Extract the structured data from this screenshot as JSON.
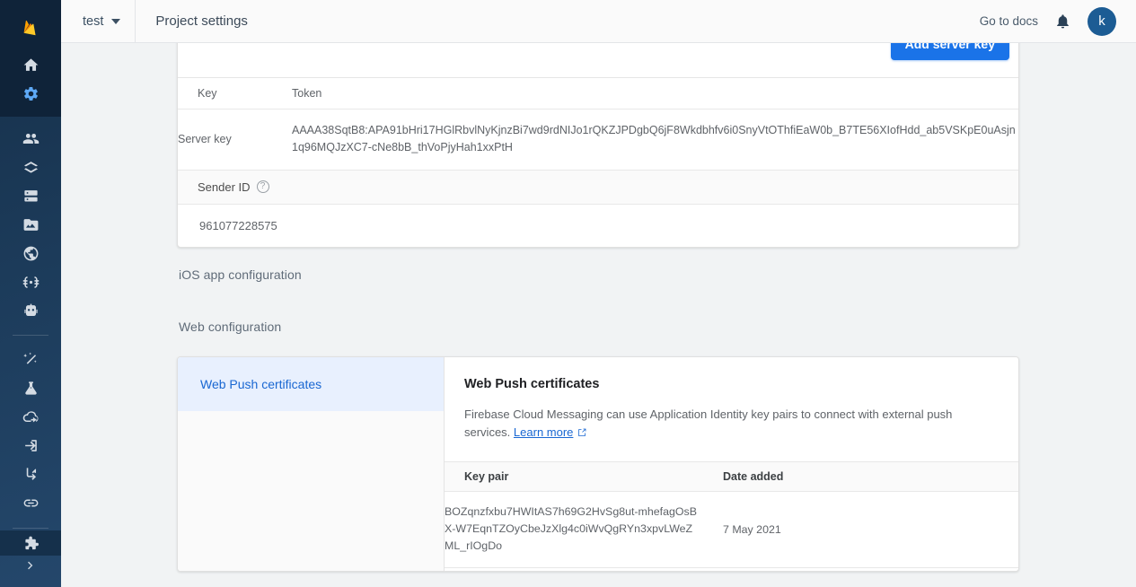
{
  "header": {
    "project_name": "test",
    "page_title": "Project settings",
    "go_to_docs": "Go to docs",
    "avatar_initial": "k",
    "accent_blue": "#1a73e8",
    "logo": "firebase-flame-logo"
  },
  "sidebar": {
    "items": [
      {
        "name": "home",
        "icon": "home-icon",
        "active": false
      },
      {
        "name": "project-settings",
        "icon": "gear-icon",
        "active": true
      },
      {
        "name": "authentication",
        "icon": "people-icon",
        "active": false
      },
      {
        "name": "firestore-database",
        "icon": "firestore-icon",
        "active": false
      },
      {
        "name": "realtime-database",
        "icon": "database-icon",
        "active": false
      },
      {
        "name": "storage",
        "icon": "folder-image-icon",
        "active": false
      },
      {
        "name": "hosting",
        "icon": "globe-icon",
        "active": false
      },
      {
        "name": "functions",
        "icon": "braces-icon",
        "active": false
      },
      {
        "name": "machine-learning",
        "icon": "robot-icon",
        "active": false
      },
      {
        "name": "crashlytics",
        "icon": "magic-wand-icon",
        "active": false
      },
      {
        "name": "ab-testing",
        "icon": "flask-icon",
        "active": false
      },
      {
        "name": "cloud-messaging",
        "icon": "cloud-arrow-icon",
        "active": false
      },
      {
        "name": "app-distribution",
        "icon": "login-arrow-icon",
        "active": false
      },
      {
        "name": "remote-config",
        "icon": "branch-icon",
        "active": false
      },
      {
        "name": "dynamic-links",
        "icon": "link-icon",
        "active": false
      },
      {
        "name": "extensions",
        "icon": "puzzle-piece-icon",
        "active": false
      }
    ],
    "expand": "chevron-right-icon"
  },
  "server_key_card": {
    "add_server_key_label": "Add server key",
    "columns": [
      "Key",
      "Token"
    ],
    "rows": [
      {
        "key": "Server key",
        "token": "AAAA38SqtB8:APA91bHri17HGlRbvlNyKjnzBi7wd9rdNIJo1rQKZJPDgbQ6jF8Wkdbhfv6i0SnyVtOThfiEaW0b_B7TE56XIofHdd_ab5VSKpE0uAsjn1q96MQJzXC7-cNe8bB_thVoPjyHah1xxPtH"
      }
    ],
    "sender_id_label": "Sender ID",
    "sender_id_help": "?",
    "sender_id_value": "961077228575"
  },
  "sections": {
    "ios_app_configuration": "iOS app configuration",
    "web_configuration": "Web configuration"
  },
  "web_push_card": {
    "tab_label": "Web Push certificates",
    "title": "Web Push certificates",
    "description": "Firebase Cloud Messaging can use Application Identity key pairs to connect with external push services.",
    "learn_more": "Learn more",
    "learn_more_icon": "open-in-new-icon",
    "columns": [
      "Key pair",
      "Date added"
    ],
    "rows": [
      {
        "key_pair": "BOZqnzfxbu7HWItAS7h69G2HvSg8ut-mhefagOsBX-W7EqnTZOyCbeJzXlg4c0iWvQgRYn3xpvLWeZML_rIOgDo",
        "date_added": "7 May 2021"
      }
    ]
  }
}
